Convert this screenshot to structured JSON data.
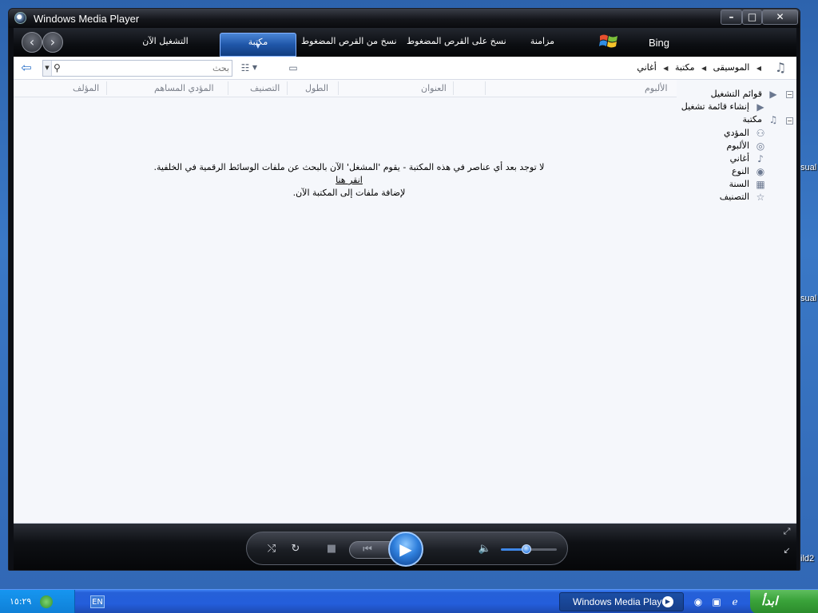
{
  "window": {
    "title": "Windows Media Player",
    "controls": {
      "minimize": "–",
      "maximize": "□",
      "close": "✕"
    }
  },
  "nav": {
    "back_icon": "arrow-left-icon",
    "forward_icon": "arrow-right-icon",
    "tabs": [
      {
        "label": "التشغيل الآن"
      },
      {
        "label": "مكتبة",
        "active": true
      },
      {
        "label": "نسخ من القرص المضغوط"
      },
      {
        "label": "نسخ على القرص المضغوط"
      },
      {
        "label": "مزامنة"
      }
    ],
    "bing": "Bing"
  },
  "toolbar": {
    "search_placeholder": "بحث",
    "breadcrumb": [
      "الموسيقى",
      "مكتبة",
      "أغاني"
    ]
  },
  "columns": [
    "الألبوم",
    "العنوان",
    "الطول",
    "التصنيف",
    "المؤدي المساهم",
    "المؤلف"
  ],
  "message": {
    "line1": "لا توجد بعد أي عناصر في هذه المكتبة - يقوم 'المشغل' الآن بالبحث عن ملفات الوسائط الرقمية في الخلفية.",
    "link": "انقر هنا",
    "line2": "لإضافة ملفات إلى المكتبة الآن."
  },
  "tree": {
    "playlists": "قوائم التشغيل",
    "create_playlist": "إنشاء قائمة تشغيل",
    "library": "مكتبة",
    "items": [
      {
        "label": "المؤدي",
        "icon": "artist-icon"
      },
      {
        "label": "الألبوم",
        "icon": "album-icon"
      },
      {
        "label": "أغاني",
        "icon": "song-icon"
      },
      {
        "label": "النوع",
        "icon": "genre-icon"
      },
      {
        "label": "السنة",
        "icon": "year-icon"
      },
      {
        "label": "التصنيف",
        "icon": "rating-icon"
      }
    ]
  },
  "player": {
    "volume_level": 0.45
  },
  "taskbar": {
    "clock": "١٥:٢٩",
    "language": "EN",
    "task_label": "Windows Media Player",
    "start": "ابدأ"
  },
  "desktop_fragments": [
    "sual",
    "sual",
    "ild2"
  ]
}
